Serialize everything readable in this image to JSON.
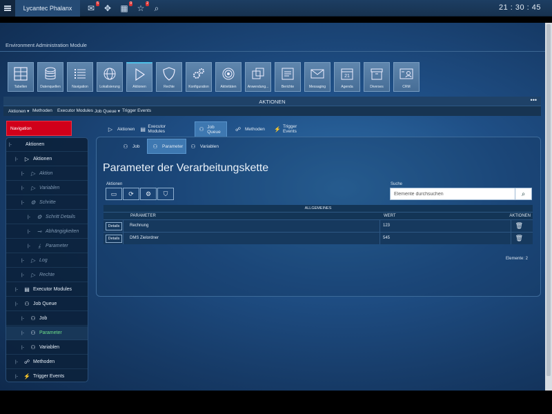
{
  "topbar": {
    "app_title": "Lycantec Phalanx",
    "icons": [
      {
        "name": "mail-icon",
        "glyph": "✉",
        "badge": "5"
      },
      {
        "name": "move-icon",
        "glyph": "✥",
        "badge": ""
      },
      {
        "name": "calendar-icon",
        "glyph": "▦",
        "badge": "9"
      },
      {
        "name": "star-icon",
        "glyph": "☆",
        "badge": "2"
      },
      {
        "name": "search-icon",
        "glyph": "⌕",
        "badge": ""
      }
    ],
    "clock": "21 : 30 : 45"
  },
  "env_title": "Environment Administration Module",
  "modules": [
    {
      "label": "Tabellen",
      "icon": "grid-icon"
    },
    {
      "label": "Datenquellen",
      "icon": "database-icon"
    },
    {
      "label": "Navigation",
      "icon": "list-icon"
    },
    {
      "label": "Lokalisierung",
      "icon": "globe-icon"
    },
    {
      "label": "Aktionen",
      "icon": "play-icon",
      "active": true
    },
    {
      "label": "Rechte",
      "icon": "shield-icon"
    },
    {
      "label": "Konfiguration",
      "icon": "gears-icon"
    },
    {
      "label": "Aktivitäten",
      "icon": "target-icon"
    },
    {
      "label": "Anwendung...",
      "icon": "windows-icon"
    },
    {
      "label": "Berichte",
      "icon": "report-icon"
    },
    {
      "label": "Messaging",
      "icon": "envelope-icon"
    },
    {
      "label": "Agenda",
      "icon": "calendar-icon"
    },
    {
      "label": "Diverses",
      "icon": "box-icon"
    },
    {
      "label": "CRM",
      "icon": "contact-card-icon"
    }
  ],
  "panel": {
    "title": "AKTIONEN",
    "menu": [
      "Aktionen ▾",
      "Methoden",
      "Executor Modules",
      "Job Queue ▾",
      "Trigger Events"
    ]
  },
  "nav_title": "Navigation",
  "tree": [
    {
      "prefix": "|-",
      "label": "Aktionen",
      "icon": "",
      "indent": 0
    },
    {
      "prefix": "|-",
      "label": "Aktionen",
      "icon": "▷",
      "indent": 1
    },
    {
      "prefix": "|-",
      "label": "Aktion",
      "icon": "▷",
      "indent": 2,
      "dim": true
    },
    {
      "prefix": "|-",
      "label": "Variablen",
      "icon": "▷",
      "indent": 2,
      "dim": true
    },
    {
      "prefix": "|-",
      "label": "Schritte",
      "icon": "⚙",
      "indent": 2,
      "dim": true
    },
    {
      "prefix": "|-",
      "label": "Schritt Details",
      "icon": "⚙",
      "indent": 3,
      "dim": true
    },
    {
      "prefix": "|-",
      "label": "Abhängigkeiten",
      "icon": "⊸",
      "indent": 3,
      "dim": true
    },
    {
      "prefix": "|-",
      "label": "Parameter",
      "icon": "⤓",
      "indent": 3,
      "dim": true
    },
    {
      "prefix": "|-",
      "label": "Log",
      "icon": "▷",
      "indent": 2,
      "dim": true
    },
    {
      "prefix": "|-",
      "label": "Rechte",
      "icon": "▷",
      "indent": 2,
      "dim": true
    },
    {
      "prefix": "|-",
      "label": "Executor Modules",
      "icon": "▤",
      "indent": 1
    },
    {
      "prefix": "|-",
      "label": "Job Queue",
      "icon": "⚇",
      "indent": 1
    },
    {
      "prefix": "|-",
      "label": "Job",
      "icon": "⚇",
      "indent": 2
    },
    {
      "prefix": "|-",
      "label": "Parameter",
      "icon": "⚇",
      "indent": 2,
      "green": true
    },
    {
      "prefix": "|-",
      "label": "Variablen",
      "icon": "⚇",
      "indent": 2
    },
    {
      "prefix": "|-",
      "label": "Methoden",
      "icon": "☍",
      "indent": 1
    },
    {
      "prefix": "|-",
      "label": "Trigger Events",
      "icon": "⚡",
      "indent": 1
    }
  ],
  "tabs1": [
    {
      "label": "Aktionen",
      "icon": "▷"
    },
    {
      "label": "Executor Modules",
      "icon": "▤"
    },
    {
      "label": "Job Queue",
      "icon": "⚇",
      "active": true
    },
    {
      "label": "Methoden",
      "icon": "☍"
    },
    {
      "label": "Trigger Events",
      "icon": "⚡"
    }
  ],
  "tabs2": [
    {
      "label": "Job",
      "icon": "⚇"
    },
    {
      "label": "Parameter",
      "icon": "⚇",
      "active": true
    },
    {
      "label": "Variablen",
      "icon": "⚇"
    }
  ],
  "content": {
    "heading": "Parameter der Verarbeitungskette",
    "actions_label": "Aktionen",
    "action_buttons": [
      {
        "name": "monitor-icon",
        "glyph": "▭"
      },
      {
        "name": "refresh-icon",
        "glyph": "⟳"
      },
      {
        "name": "gears-icon",
        "glyph": "⚙"
      },
      {
        "name": "shield-icon",
        "glyph": "⛉"
      }
    ],
    "search_label": "Suche",
    "search_placeholder": "Elemente durchsuchen",
    "table": {
      "group_header": "ALLGEMEINES",
      "columns": [
        "PARAMETER",
        "WERT",
        "AKTIONEN"
      ],
      "details_label": "Details",
      "rows": [
        {
          "parameter": "Rechnung",
          "wert": "123"
        },
        {
          "parameter": "DMS Zielordner",
          "wert": "545"
        }
      ]
    },
    "count": "Elemente: 2"
  }
}
